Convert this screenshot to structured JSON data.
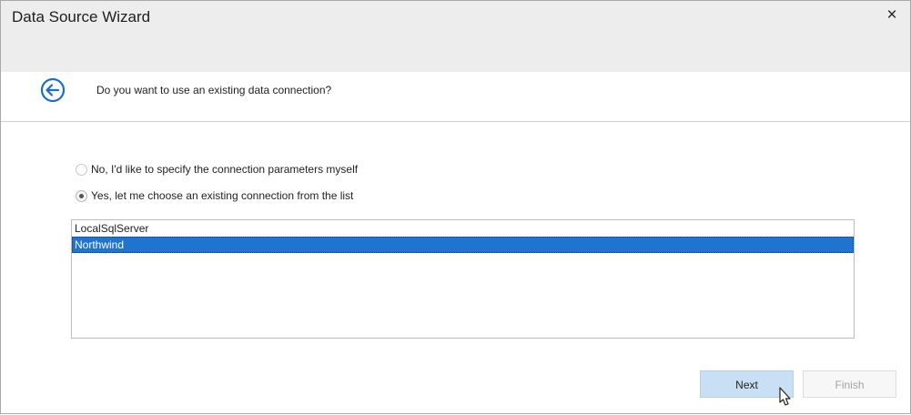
{
  "window": {
    "title": "Data Source Wizard",
    "close_glyph": "×"
  },
  "header": {
    "question": "Do you want to use an existing data connection?",
    "back_icon": "back-arrow-circle-icon"
  },
  "options": [
    {
      "label": "No, I'd like to specify the connection parameters myself",
      "checked": false
    },
    {
      "label": "Yes, let me choose an existing connection from the list",
      "checked": true
    }
  ],
  "connections": {
    "items": [
      "LocalSqlServer",
      "Northwind"
    ],
    "selected": "Northwind"
  },
  "footer": {
    "next_label": "Next",
    "finish_label": "Finish",
    "finish_enabled": false
  },
  "colors": {
    "accent": "#1e74cf",
    "next_button_bg": "#c9dff3",
    "titlebar_bg": "#ededed"
  }
}
